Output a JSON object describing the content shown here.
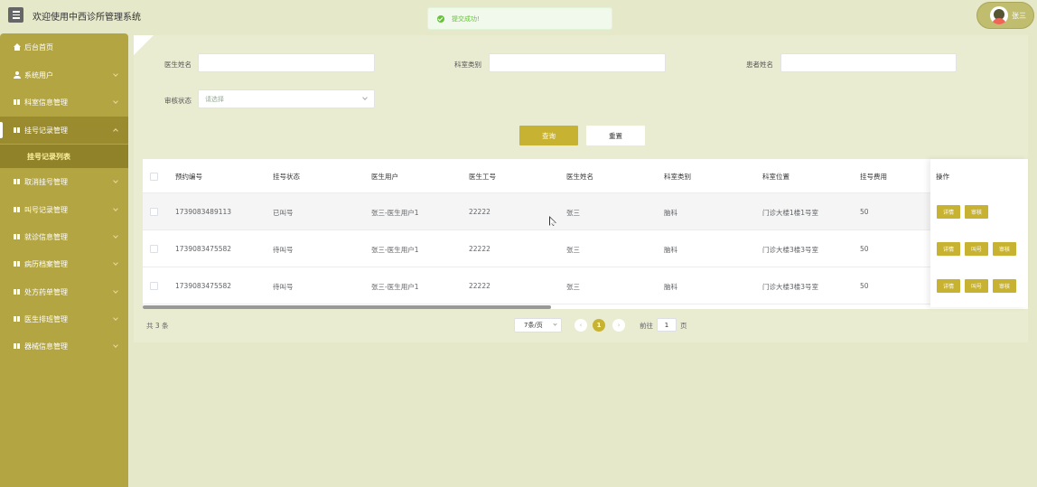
{
  "header": {
    "app_title": "欢迎使用中西诊所管理系统",
    "toast_message": "提交成功!",
    "user_name": "张三"
  },
  "sidebar": {
    "items": [
      {
        "label": "后台首页",
        "icon": "home-icon",
        "expandable": false
      },
      {
        "label": "系统用户",
        "icon": "user-icon",
        "expandable": true
      },
      {
        "label": "科室信息管理",
        "icon": "grid-icon",
        "expandable": true
      },
      {
        "label": "挂号记录管理",
        "icon": "grid-icon",
        "expandable": true,
        "expanded": true
      },
      {
        "label": "取消挂号管理",
        "icon": "grid-icon",
        "expandable": true
      },
      {
        "label": "叫号记录管理",
        "icon": "grid-icon",
        "expandable": true
      },
      {
        "label": "就诊信息管理",
        "icon": "grid-icon",
        "expandable": true
      },
      {
        "label": "病历档案管理",
        "icon": "grid-icon",
        "expandable": true
      },
      {
        "label": "处方药单管理",
        "icon": "grid-icon",
        "expandable": true
      },
      {
        "label": "医生排班管理",
        "icon": "grid-icon",
        "expandable": true
      },
      {
        "label": "器械信息管理",
        "icon": "grid-icon",
        "expandable": true
      }
    ],
    "active_sub": "挂号记录列表"
  },
  "search": {
    "doctor_name_label": "医生姓名",
    "dept_type_label": "科室类别",
    "patient_name_label": "患者姓名",
    "audit_status_label": "审核状态",
    "audit_status_placeholder": "请选择",
    "query_button": "查询",
    "reset_button": "重置"
  },
  "table": {
    "headers": [
      "预约编号",
      "挂号状态",
      "医生用户",
      "医生工号",
      "医生姓名",
      "科室类别",
      "科室位置",
      "挂号费用",
      "操作"
    ],
    "rows": [
      {
        "id": "1739083489113",
        "status": "已叫号",
        "doctor_user": "张三-医生用户1",
        "doctor_no": "22222",
        "doctor_name": "张三",
        "dept": "脑科",
        "location": "门诊大楼1楼1号室",
        "fee": "50",
        "actions": [
          "详情",
          "审核"
        ]
      },
      {
        "id": "1739083475582",
        "status": "待叫号",
        "doctor_user": "张三-医生用户1",
        "doctor_no": "22222",
        "doctor_name": "张三",
        "dept": "脑科",
        "location": "门诊大楼3楼3号室",
        "fee": "50",
        "actions": [
          "详情",
          "叫号",
          "审核"
        ]
      },
      {
        "id": "1739083475582",
        "status": "待叫号",
        "doctor_user": "张三-医生用户1",
        "doctor_no": "22222",
        "doctor_name": "张三",
        "dept": "脑科",
        "location": "门诊大楼3楼3号室",
        "fee": "50",
        "actions": [
          "详情",
          "叫号",
          "审核"
        ]
      }
    ]
  },
  "pagination": {
    "total": "共 3 条",
    "page_size": "7条/页",
    "current_page": "1",
    "goto_label": "前往",
    "goto_value": "1",
    "page_suffix": "页"
  },
  "colors": {
    "sidebar": "#b3a541",
    "accent": "#c8b232",
    "background": "#e6e8ca",
    "toast_bg": "#f0f9eb",
    "toast_text": "#67c23a"
  }
}
